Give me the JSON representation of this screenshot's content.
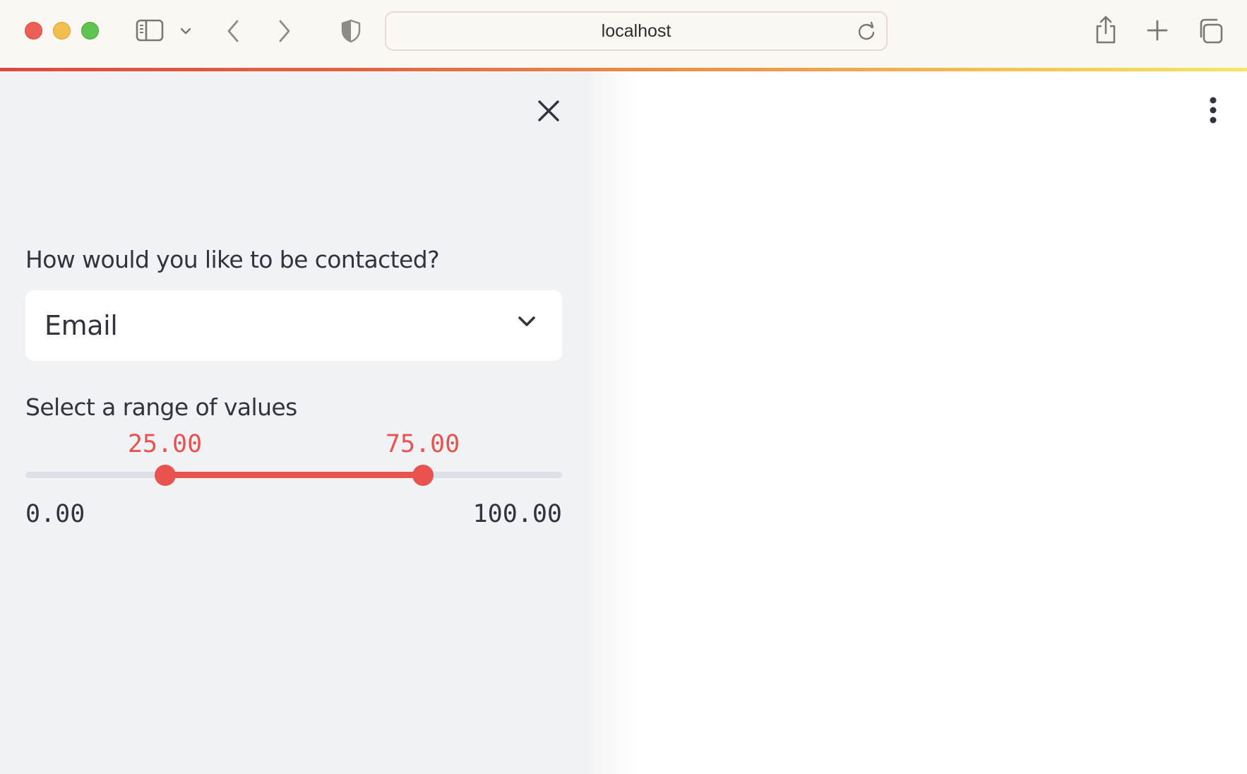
{
  "browser": {
    "address": "localhost",
    "icons": {
      "sidebar_toggle": "sidebar-icon",
      "sidebar_chevron": "chevron-down-icon",
      "back": "chevron-left-icon",
      "forward": "chevron-right-icon",
      "privacy": "shield-icon",
      "reload": "reload-icon",
      "share": "share-icon",
      "new_tab": "plus-icon",
      "tab_overview": "tabs-icon"
    },
    "loading_gradient": [
      "#d84a44",
      "#f7e764"
    ]
  },
  "sidebar": {
    "close_icon": "close-icon",
    "contact_select": {
      "label": "How would you like to be contacted?",
      "value": "Email"
    },
    "range_slider": {
      "label": "Select a range of values",
      "min": 0,
      "max": 100,
      "low": 25,
      "high": 75,
      "low_label": "25.00",
      "high_label": "75.00",
      "min_label": "0.00",
      "max_label": "100.00",
      "accent_color": "#e8534f"
    }
  },
  "main": {
    "menu_icon": "kebab-menu-icon"
  },
  "colors": {
    "sidebar_bg": "#f0f2f6",
    "text": "#31333f",
    "accent": "#e8534f"
  }
}
